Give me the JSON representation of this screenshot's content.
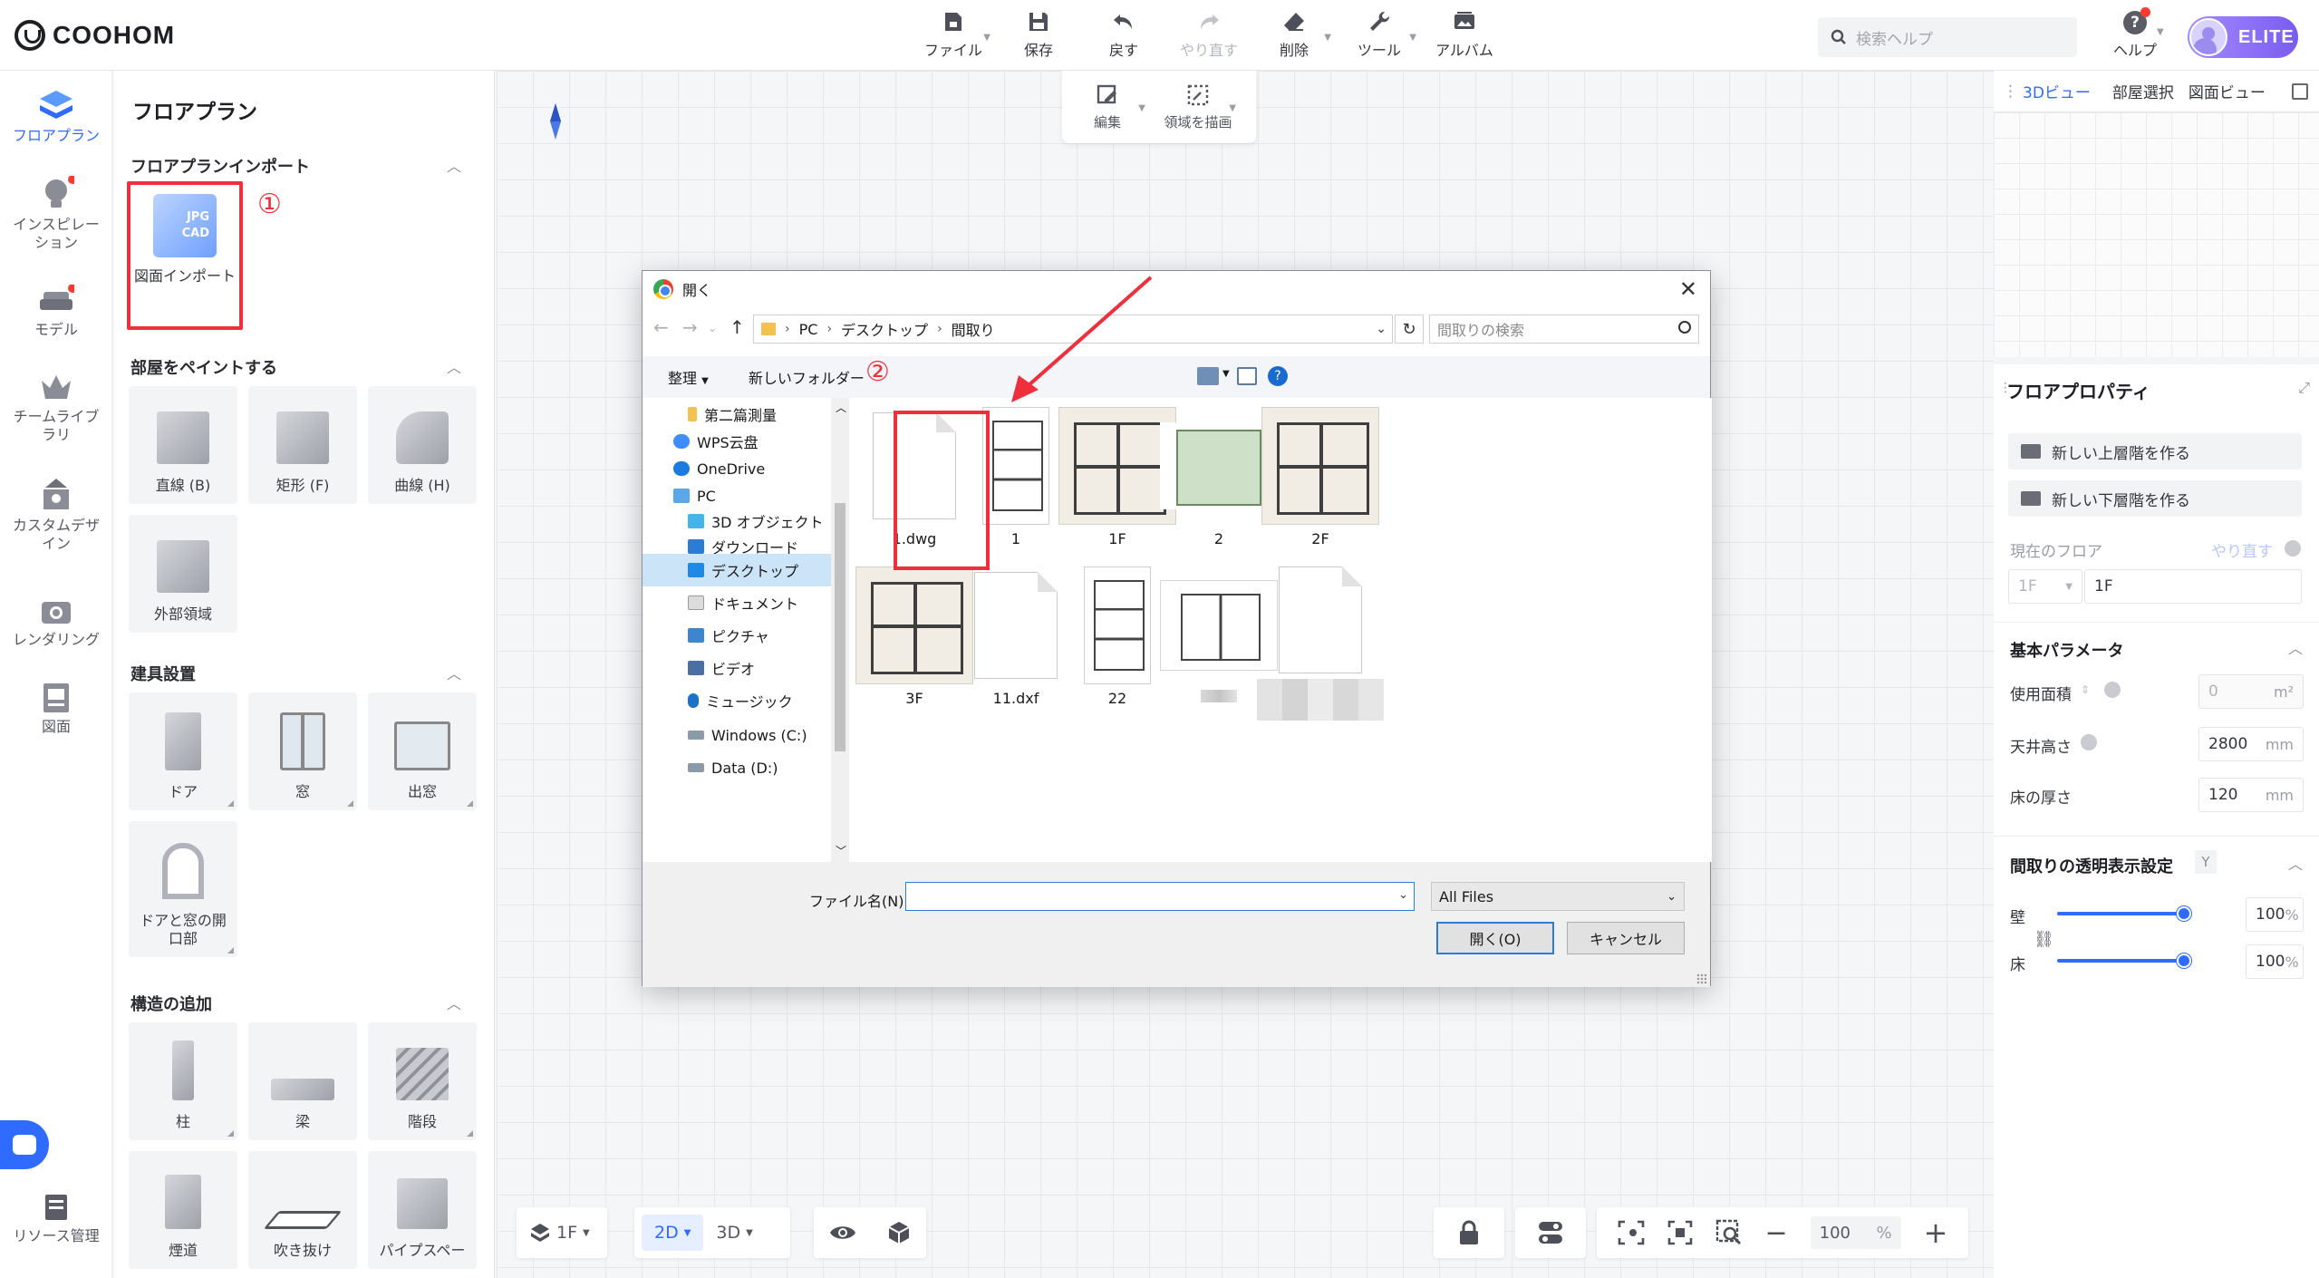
{
  "app": {
    "logo": "COOHOM"
  },
  "toolbar": {
    "items": [
      {
        "label": "ファイル",
        "icon": "file-icon",
        "caret": true,
        "disabled": false
      },
      {
        "label": "保存",
        "icon": "save-icon",
        "caret": false,
        "disabled": false
      },
      {
        "label": "戻す",
        "icon": "undo-icon",
        "caret": false,
        "disabled": false
      },
      {
        "label": "やり直す",
        "icon": "redo-icon",
        "caret": false,
        "disabled": true
      },
      {
        "label": "削除",
        "icon": "eraser-icon",
        "caret": true,
        "disabled": false
      },
      {
        "label": "ツール",
        "icon": "wrench-icon",
        "caret": true,
        "disabled": false
      },
      {
        "label": "アルバム",
        "icon": "album-icon",
        "caret": false,
        "disabled": false
      }
    ],
    "search_placeholder": "検索ヘルプ",
    "help_label": "ヘルプ",
    "badge": "ELITE"
  },
  "rail": {
    "items": [
      {
        "label": "フロアプラン",
        "icon": "floorplan-icon",
        "active": true,
        "dot": false
      },
      {
        "label": "インスピレーション",
        "icon": "lightbulb-icon",
        "active": false,
        "dot": true
      },
      {
        "label": "モデル",
        "icon": "sofa-icon",
        "active": false,
        "dot": true
      },
      {
        "label": "チームライブラリ",
        "icon": "crown-icon",
        "active": false,
        "dot": false
      },
      {
        "label": "カスタムデザイン",
        "icon": "custom-design-icon",
        "active": false,
        "dot": false
      },
      {
        "label": "レンダリング",
        "icon": "camera-icon",
        "active": false,
        "dot": false
      },
      {
        "label": "図面",
        "icon": "drawing-icon",
        "active": false,
        "dot": false
      },
      {
        "label": "リソース管理",
        "icon": "resource-icon",
        "active": false,
        "dot": false
      }
    ]
  },
  "panel": {
    "title": "フロアプラン",
    "sections": {
      "import": {
        "title": "フロアプランインポート",
        "card_label": "図面インポート",
        "icon_text_top": "JPG",
        "icon_text_bottom": "CAD",
        "marker": "①"
      },
      "paint": {
        "title": "部屋をペイントする",
        "cards": [
          "直線 (B)",
          "矩形 (F)",
          "曲線 (H)",
          "外部領域"
        ]
      },
      "fixtures": {
        "title": "建具設置",
        "cards": [
          "ドア",
          "窓",
          "出窓",
          "ドアと窓の開口部"
        ]
      },
      "structure": {
        "title": "構造の追加",
        "cards": [
          "柱",
          "梁",
          "階段",
          "煙道",
          "吹き抜け",
          "パイプスペー"
        ]
      }
    }
  },
  "canvas": {
    "subtools": [
      {
        "label": "編集",
        "icon": "edit-icon"
      },
      {
        "label": "領域を描画",
        "icon": "draw-area-icon"
      }
    ]
  },
  "bottom": {
    "floor": "1F",
    "mode_2d": "2D",
    "mode_3d": "3D",
    "zoom": "100",
    "zoom_unit": "%"
  },
  "right": {
    "tabs": [
      {
        "label": "3Dビュー",
        "active": true
      },
      {
        "label": "部屋選択",
        "active": false
      },
      {
        "label": "図面ビュー",
        "active": false
      }
    ],
    "props_title": "フロアプロパティ",
    "btn_upper": "新しい上層階を作る",
    "btn_lower": "新しい下層階を作る",
    "current_floor_label": "現在のフロア",
    "redo_link": "やり直す",
    "floor_select": "1F",
    "floor_name": "1F",
    "basic_params": "基本パラメータ",
    "area_label": "使用面積",
    "area_value": "0",
    "area_unit": "m²",
    "ceiling_label": "天井高さ",
    "ceiling_value": "2800",
    "ceiling_unit": "mm",
    "floor_thick_label": "床の厚さ",
    "floor_thick_value": "120",
    "floor_thick_unit": "mm",
    "transparency_title": "間取りの透明表示設定",
    "transparency_key": "Y",
    "wall_label": "壁",
    "wall_value": "100",
    "floor_label": "床",
    "floor_value": "100",
    "pct": "%"
  },
  "dialog": {
    "title": "開く",
    "path": [
      "PC",
      "デスクトップ",
      "間取り"
    ],
    "search_placeholder": "間取りの検索",
    "organize": "整理",
    "new_folder": "新しいフォルダー",
    "nav": [
      {
        "label": "第二篇測量",
        "icon": "folder-icon",
        "selected": false
      },
      {
        "label": "WPS云盘",
        "icon": "cloud-icon",
        "selected": false
      },
      {
        "label": "OneDrive",
        "icon": "onedrive-icon",
        "selected": false
      },
      {
        "label": "PC",
        "icon": "pc-icon",
        "selected": false
      },
      {
        "label": "3D オブジェクト",
        "icon": "3d-objects-icon",
        "selected": false
      },
      {
        "label": "ダウンロード",
        "icon": "download-icon",
        "selected": false
      },
      {
        "label": "デスクトップ",
        "icon": "desktop-icon",
        "selected": true
      },
      {
        "label": "ドキュメント",
        "icon": "documents-icon",
        "selected": false
      },
      {
        "label": "ピクチャ",
        "icon": "pictures-icon",
        "selected": false
      },
      {
        "label": "ビデオ",
        "icon": "videos-icon",
        "selected": false
      },
      {
        "label": "ミュージック",
        "icon": "music-icon",
        "selected": false
      },
      {
        "label": "Windows (C:)",
        "icon": "drive-icon",
        "selected": false
      },
      {
        "label": "Data (D:)",
        "icon": "drive-icon",
        "selected": false
      }
    ],
    "files": [
      {
        "name": "1.dwg",
        "kind": "doc"
      },
      {
        "name": "1",
        "kind": "sheet"
      },
      {
        "name": "1F",
        "kind": "plan"
      },
      {
        "name": "2",
        "kind": "greenplan"
      },
      {
        "name": "2F",
        "kind": "plan"
      },
      {
        "name": "3F",
        "kind": "plan"
      },
      {
        "name": "11.dxf",
        "kind": "doc"
      },
      {
        "name": "22",
        "kind": "sheet"
      },
      {
        "name": "",
        "kind": "wideplan"
      },
      {
        "name": "",
        "kind": "doc"
      }
    ],
    "marker": "②",
    "filename_label": "ファイル名(N):",
    "filename_value": "",
    "filetype": "All Files",
    "open_btn": "開く(O)",
    "cancel_btn": "キャンセル"
  },
  "colors": {
    "accent": "#2f6bff",
    "annotation": "#ef2f3c",
    "elite_gradient_start": "#a48bff",
    "elite_gradient_end": "#7a5cf0"
  }
}
